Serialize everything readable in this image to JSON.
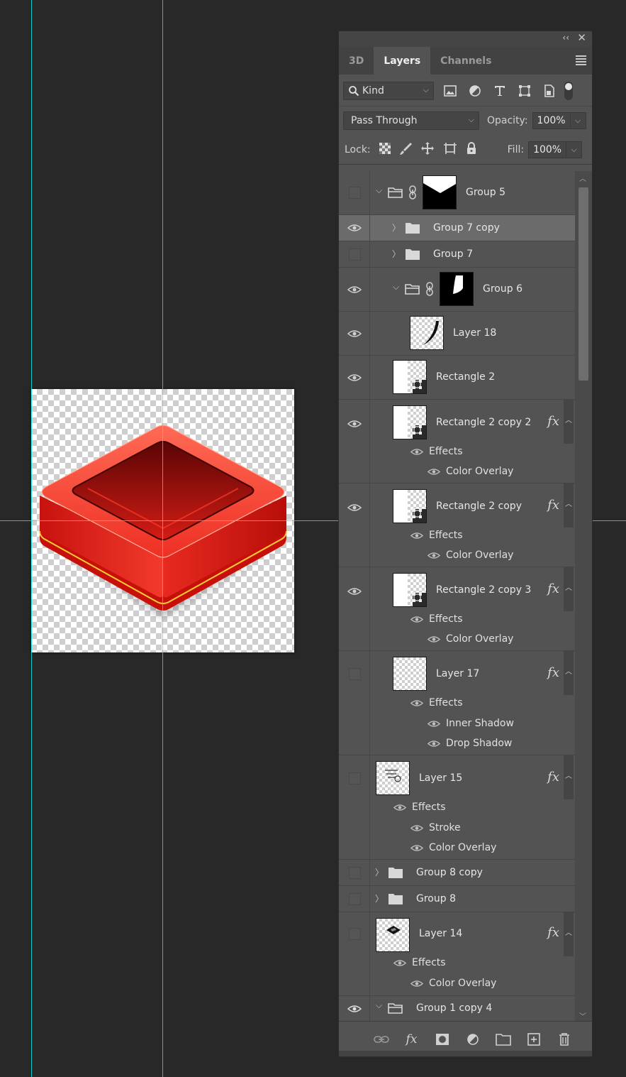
{
  "panel": {
    "collapse_glyph": "‹‹",
    "close_glyph": "✕",
    "tabs": [
      {
        "label": "3D",
        "active": false
      },
      {
        "label": "Layers",
        "active": true
      },
      {
        "label": "Channels",
        "active": false
      }
    ]
  },
  "filter": {
    "kind_label": "Kind",
    "icons": [
      "image-filter-icon",
      "adjustment-filter-icon",
      "type-filter-icon",
      "shape-filter-icon",
      "smart-object-filter-icon"
    ]
  },
  "blend": {
    "mode": "Pass Through",
    "opacity_label": "Opacity:",
    "opacity_value": "100%"
  },
  "lock": {
    "label": "Lock:",
    "fill_label": "Fill:",
    "fill_value": "100%"
  },
  "layers": [
    {
      "name": "Group 5",
      "visible": false,
      "kind": "group",
      "expanded": true,
      "mask": true,
      "linked": true
    },
    {
      "name": "Group 7 copy",
      "visible": true,
      "kind": "group",
      "expanded": false,
      "selected": true
    },
    {
      "name": "Group 7",
      "visible": false,
      "kind": "group",
      "expanded": false
    },
    {
      "name": "Group 6",
      "visible": true,
      "kind": "group",
      "expanded": true,
      "mask": true,
      "linked": true
    },
    {
      "name": "Layer 18",
      "visible": true,
      "kind": "pixel"
    },
    {
      "name": "Rectangle 2",
      "visible": true,
      "kind": "shape"
    },
    {
      "name": "Rectangle 2 copy 2",
      "visible": true,
      "kind": "shape",
      "fx": true,
      "effects_label": "Effects",
      "effects": [
        "Color Overlay"
      ]
    },
    {
      "name": "Rectangle 2 copy",
      "visible": true,
      "kind": "shape",
      "fx": true,
      "effects_label": "Effects",
      "effects": [
        "Color Overlay"
      ]
    },
    {
      "name": "Rectangle 2 copy 3",
      "visible": true,
      "kind": "shape",
      "fx": true,
      "effects_label": "Effects",
      "effects": [
        "Color Overlay"
      ]
    },
    {
      "name": "Layer 17",
      "visible": false,
      "kind": "pixel",
      "fx": true,
      "effects_label": "Effects",
      "effects": [
        "Inner Shadow",
        "Drop Shadow"
      ]
    },
    {
      "name": "Layer 15",
      "visible": false,
      "kind": "pixel",
      "fx": true,
      "effects_label": "Effects",
      "effects": [
        "Stroke",
        "Color Overlay"
      ]
    },
    {
      "name": "Group 8 copy",
      "visible": false,
      "kind": "group",
      "expanded": false
    },
    {
      "name": "Group 8",
      "visible": false,
      "kind": "group",
      "expanded": false
    },
    {
      "name": "Layer 14",
      "visible": false,
      "kind": "pixel",
      "fx": true,
      "effects_label": "Effects",
      "effects": [
        "Color Overlay"
      ]
    },
    {
      "name": "Group 1 copy 4",
      "visible": true,
      "kind": "group",
      "expanded": true
    }
  ],
  "fx_glyph": "fx",
  "colors": {
    "panel_bg": "#535353",
    "canvas_bg": "#282828",
    "guide": "#00ffff",
    "icon_red": "#e8231c"
  }
}
